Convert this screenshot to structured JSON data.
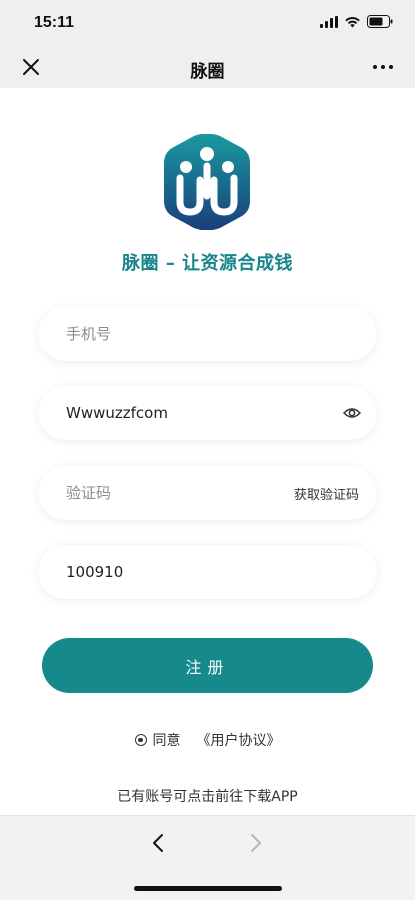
{
  "status_bar": {
    "time": "15:11",
    "icons": [
      "signal-icon",
      "wifi-icon",
      "battery-icon"
    ]
  },
  "nav": {
    "title": "脉圈",
    "close_icon": "close-icon",
    "more_icon": "more-icon"
  },
  "brand": {
    "slogan": "脉圈 – 让资源合成钱",
    "accent_color": "#16898b"
  },
  "form": {
    "phone": {
      "placeholder": "手机号",
      "value": ""
    },
    "password": {
      "value": "Wwwuzzfcom"
    },
    "code": {
      "placeholder": "验证码",
      "value": "",
      "get_code_label": "获取验证码"
    },
    "invite": {
      "value": "100910"
    },
    "submit_label": "注册"
  },
  "agreement": {
    "agree_label": "同意",
    "link_label": "《用户协议》"
  },
  "download_text": "已有账号可点击前往下载APP",
  "browser_nav": {
    "back_icon": "chevron-left-icon",
    "forward_icon": "chevron-right-icon"
  }
}
